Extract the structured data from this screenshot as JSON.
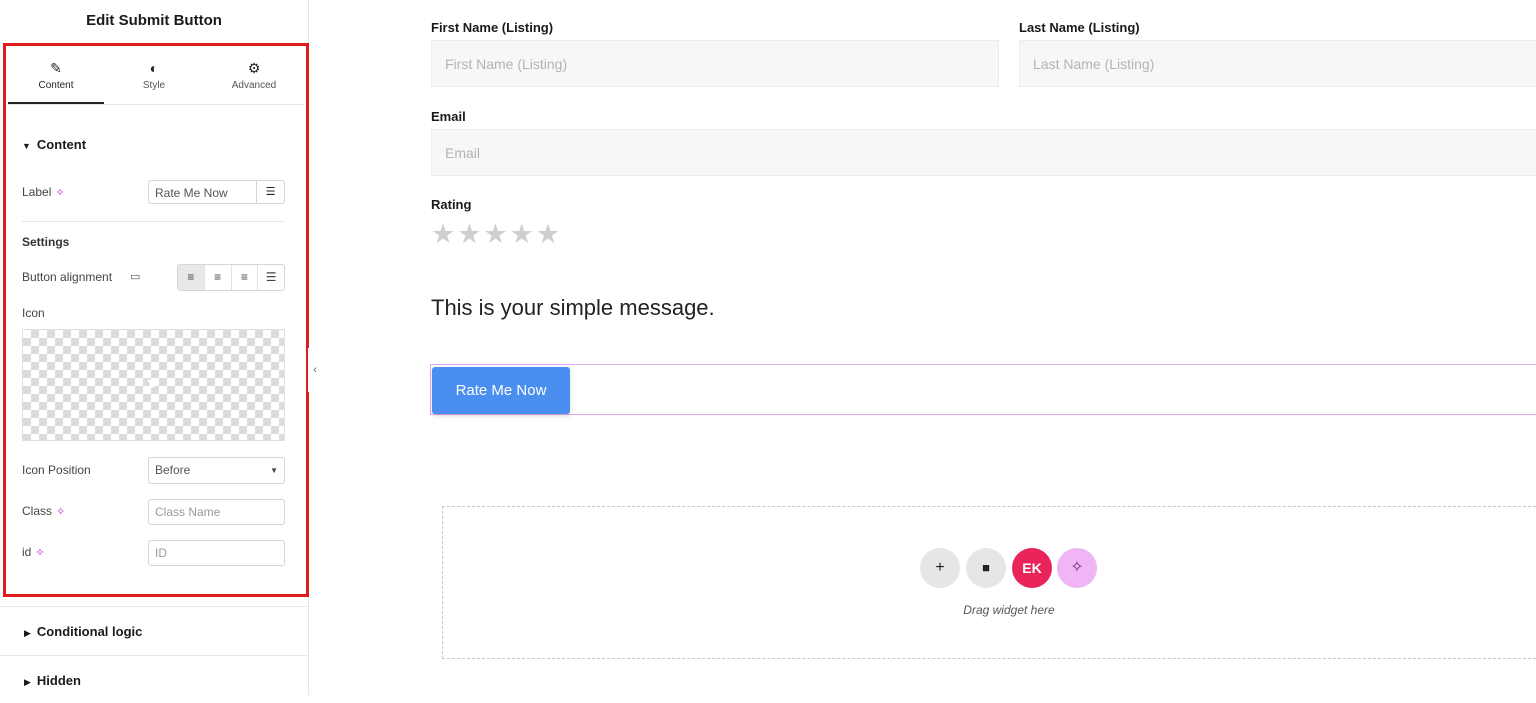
{
  "sidebar": {
    "title": "Edit Submit Button",
    "tabs": [
      {
        "label": "Content",
        "icon": "pencil-icon"
      },
      {
        "label": "Style",
        "icon": "contrast-icon"
      },
      {
        "label": "Advanced",
        "icon": "gear-icon"
      }
    ],
    "content_section": {
      "heading": "Content",
      "label_field": {
        "label": "Label",
        "value": "Rate Me Now"
      },
      "settings_heading": "Settings",
      "button_alignment": {
        "label": "Button alignment",
        "selected": "left"
      },
      "icon_field": {
        "label": "Icon"
      },
      "icon_position": {
        "label": "Icon Position",
        "value": "Before"
      },
      "class_field": {
        "label": "Class",
        "placeholder": "Class Name"
      },
      "id_field": {
        "label": "id",
        "placeholder": "ID"
      }
    },
    "collapsed_sections": [
      "Conditional logic",
      "Hidden"
    ]
  },
  "form": {
    "first_name": {
      "label": "First Name (Listing)",
      "placeholder": "First Name (Listing)"
    },
    "last_name": {
      "label": "Last Name (Listing)",
      "placeholder": "Last Name (Listing)"
    },
    "email": {
      "label": "Email",
      "placeholder": "Email"
    },
    "rating": {
      "label": "Rating",
      "stars": "★★★★★",
      "value": 0,
      "max": 5
    },
    "message": "This is your simple message.",
    "submit_label": "Rate Me Now"
  },
  "dropzone": {
    "text": "Drag widget here",
    "buttons": [
      "plus-icon",
      "folder-icon",
      "elementskit-icon",
      "ai-sparkle-icon"
    ]
  },
  "colors": {
    "highlight_border": "#e01c1c",
    "submit_bg": "#4a8ef0",
    "ai_accent": "#c026d3",
    "elementskit": "#e8245a"
  }
}
